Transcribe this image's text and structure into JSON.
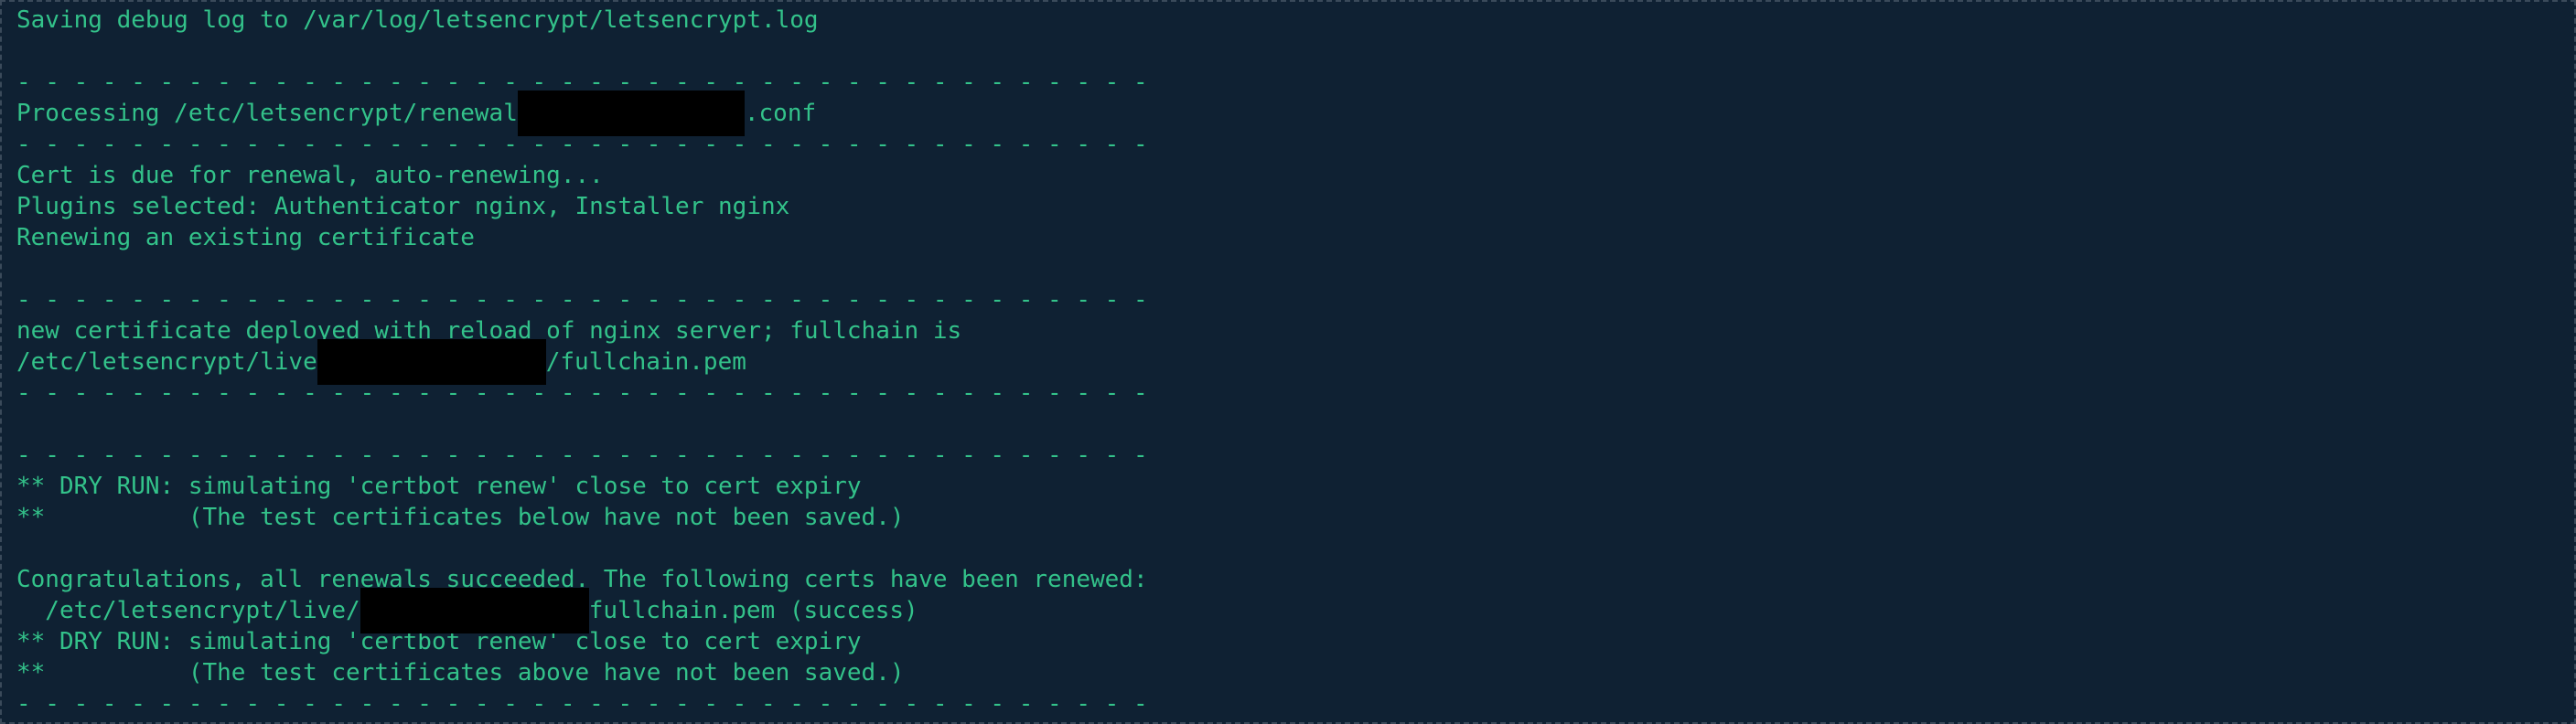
{
  "colors": {
    "background": "#0f2133",
    "text": "#33c28a",
    "redaction": "#000000"
  },
  "terminal": {
    "lines": [
      {
        "type": "text",
        "text": "Saving debug log to /var/log/letsencrypt/letsencrypt.log"
      },
      {
        "type": "blank"
      },
      {
        "type": "separator",
        "text": "- - - - - - - - - - - - - - - - - - - - - - - - - - - - - - - - - - - - - - - -"
      },
      {
        "type": "redacted",
        "before": "Processing /etc/letsencrypt/renewal",
        "after": ".conf",
        "redact": "r1"
      },
      {
        "type": "separator",
        "text": "- - - - - - - - - - - - - - - - - - - - - - - - - - - - - - - - - - - - - - - -"
      },
      {
        "type": "text",
        "text": "Cert is due for renewal, auto-renewing..."
      },
      {
        "type": "text",
        "text": "Plugins selected: Authenticator nginx, Installer nginx"
      },
      {
        "type": "text",
        "text": "Renewing an existing certificate"
      },
      {
        "type": "blank"
      },
      {
        "type": "separator",
        "text": "- - - - - - - - - - - - - - - - - - - - - - - - - - - - - - - - - - - - - - - -"
      },
      {
        "type": "text",
        "text": "new certificate deployed with reload of nginx server; fullchain is"
      },
      {
        "type": "redacted",
        "before": "/etc/letsencrypt/live",
        "after": "/fullchain.pem",
        "redact": "r2"
      },
      {
        "type": "separator",
        "text": "- - - - - - - - - - - - - - - - - - - - - - - - - - - - - - - - - - - - - - - -"
      },
      {
        "type": "blank"
      },
      {
        "type": "separator",
        "text": "- - - - - - - - - - - - - - - - - - - - - - - - - - - - - - - - - - - - - - - -"
      },
      {
        "type": "text",
        "text": "** DRY RUN: simulating 'certbot renew' close to cert expiry"
      },
      {
        "type": "text",
        "text": "**          (The test certificates below have not been saved.)"
      },
      {
        "type": "blank"
      },
      {
        "type": "text",
        "text": "Congratulations, all renewals succeeded. The following certs have been renewed:"
      },
      {
        "type": "redacted",
        "before": "  /etc/letsencrypt/live/",
        "after": "fullchain.pem (success)",
        "redact": "r3"
      },
      {
        "type": "text",
        "text": "** DRY RUN: simulating 'certbot renew' close to cert expiry"
      },
      {
        "type": "text",
        "text": "**          (The test certificates above have not been saved.)"
      },
      {
        "type": "separator",
        "text": "- - - - - - - - - - - - - - - - - - - - - - - - - - - - - - - - - - - - - - - -"
      }
    ]
  }
}
